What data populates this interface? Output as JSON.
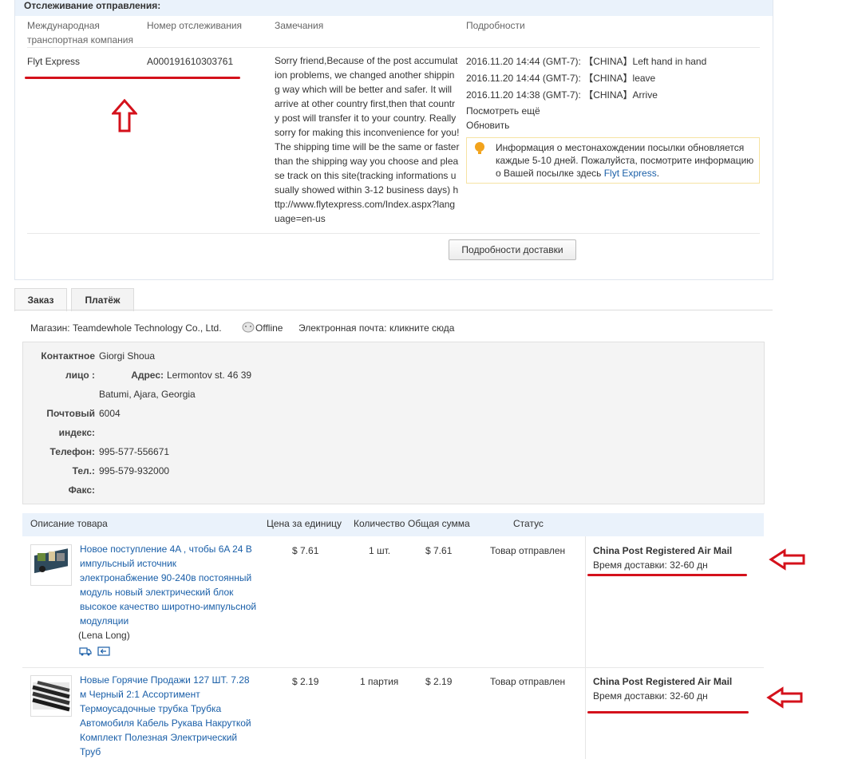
{
  "tracking": {
    "title": "Отслеживание отправления:",
    "columns": {
      "company": "Международная транспортная компания",
      "number": "Номер отслеживания",
      "remarks": "Замечания",
      "details": "Подробности"
    },
    "company": "Flyt Express",
    "tracking_number": "A00019161030376​1",
    "remark": "Sorry friend,Because of the post accumulation problems, we changed another shipping way which will be better and safer. It will arrive at other country first,then that country post will transfer it to your country. Really sorry for making this inconvenience for you! The shipping time will be the same or faster than the shipping way you choose and please track on this site(tracking informations usually showed within 3-12 business days) http://www.flytexpress.com/Index.aspx?language=en-us",
    "events": [
      "2016.11.20 14:44 (GMT-7): 【CHINA】Left hand in hand",
      "2016.11.20 14:44 (GMT-7): 【CHINA】leave",
      "2016.11.20 14:38 (GMT-7): 【CHINA】Arrive"
    ],
    "see_more": "Посмотреть ещё",
    "refresh": "Обновить",
    "info_text": "Информация о местонахождении посылки обновляется каждые 5-10 дней. Пожалуйста, посмотрите информацию о Вашей посылке здесь ",
    "info_link": "Flyt Express",
    "info_end": ".",
    "delivery_details_button": "Подробности доставки"
  },
  "tabs": [
    "Заказ",
    "Платёж"
  ],
  "store": {
    "label": "Магазин:",
    "name": "Teamdewhole Technology Co., Ltd.",
    "status": "Offline",
    "email_label": "Электронная почта:",
    "email_link": "кликните сюда"
  },
  "contact": {
    "contact_label_1": "Контактное",
    "contact_label_2": "лицо :",
    "contact_value": "Giorgi Shoua",
    "address_label": "Адрес:",
    "address_line1": "Lermontov st. 46 39",
    "address_line2": "Batumi, Ajara, Georgia",
    "zip_label_1": "Почтовый",
    "zip_label_2": "индекс:",
    "zip_value": "6004",
    "phone_label": "Телефон:",
    "phone_value": "995-577-556671",
    "tel_label": "Тел.:",
    "tel_value": "995-579-932000",
    "fax_label": "Факс:"
  },
  "table": {
    "headers": {
      "description": "Описание товара",
      "unit_price": "Цена за единицу",
      "quantity": "Количество",
      "total": "Общая сумма",
      "status": "Статус"
    },
    "rows": [
      {
        "title": "Новое поступление 4A , чтобы 6A 24 В импульсный источник электронабжение 90-240в постоянный модуль новый электрический блок высокое качество широтно-импульсной модуляции",
        "seller": "(Lena Long)",
        "price": "$ 7.61",
        "quantity": "1 шт.",
        "total": "$ 7.61",
        "status": "Товар отправлен",
        "shipping": "China Post Registered Air Mail",
        "delivery_time": "Время доставки:  32-60 дн"
      },
      {
        "title": "Новые Горячие Продажи 127 ШТ. 7.28 м Черный 2:1 Ассортимент Термоусадочные трубка Трубка Автомобиля Кабель Рукава Накруткой Комплект Полезная Электрический Труб",
        "seller": "",
        "price": "$ 2.19",
        "quantity": "1 партия",
        "total": "$ 2.19",
        "status": "Товар отправлен",
        "shipping": "China Post Registered Air Mail",
        "delivery_time": "Время доставки:  32-60 дн"
      }
    ]
  },
  "colors": {
    "annotation_red": "#d4111b",
    "link_blue": "#1a5fa8",
    "header_bg": "#eaf2fb"
  }
}
